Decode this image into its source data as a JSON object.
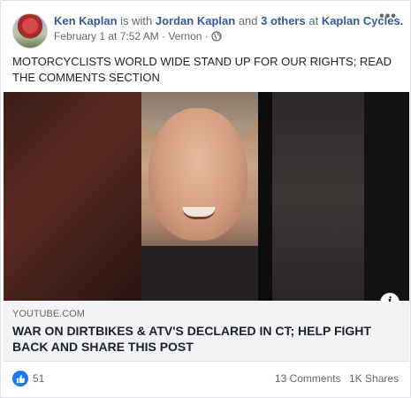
{
  "post": {
    "author": "Ken Kaplan",
    "with_text": "is with",
    "tagged_person": "Jordan Kaplan",
    "and_text": "and",
    "others": "3 others",
    "at_text": "at",
    "place": "Kaplan Cycles.",
    "date": "February 1 at 7:52 AM",
    "location": "Vernon",
    "separator": "·",
    "body": "MOTORCYCLISTS WORLD WIDE STAND UP FOR OUR RIGHTS; READ THE COMMENTS SECTION",
    "more_label": "•••"
  },
  "link": {
    "domain": "YOUTUBE.COM",
    "title": "WAR ON DIRTBIKES & ATV'S DECLARED IN CT; HELP FIGHT BACK AND SHARE THIS POST",
    "info_label": "i"
  },
  "stats": {
    "likes": "51",
    "comments": "13 Comments",
    "shares": "1K Shares"
  },
  "colors": {
    "link_blue": "#365899",
    "like_blue": "#1877f2",
    "meta_gray": "#616770"
  }
}
